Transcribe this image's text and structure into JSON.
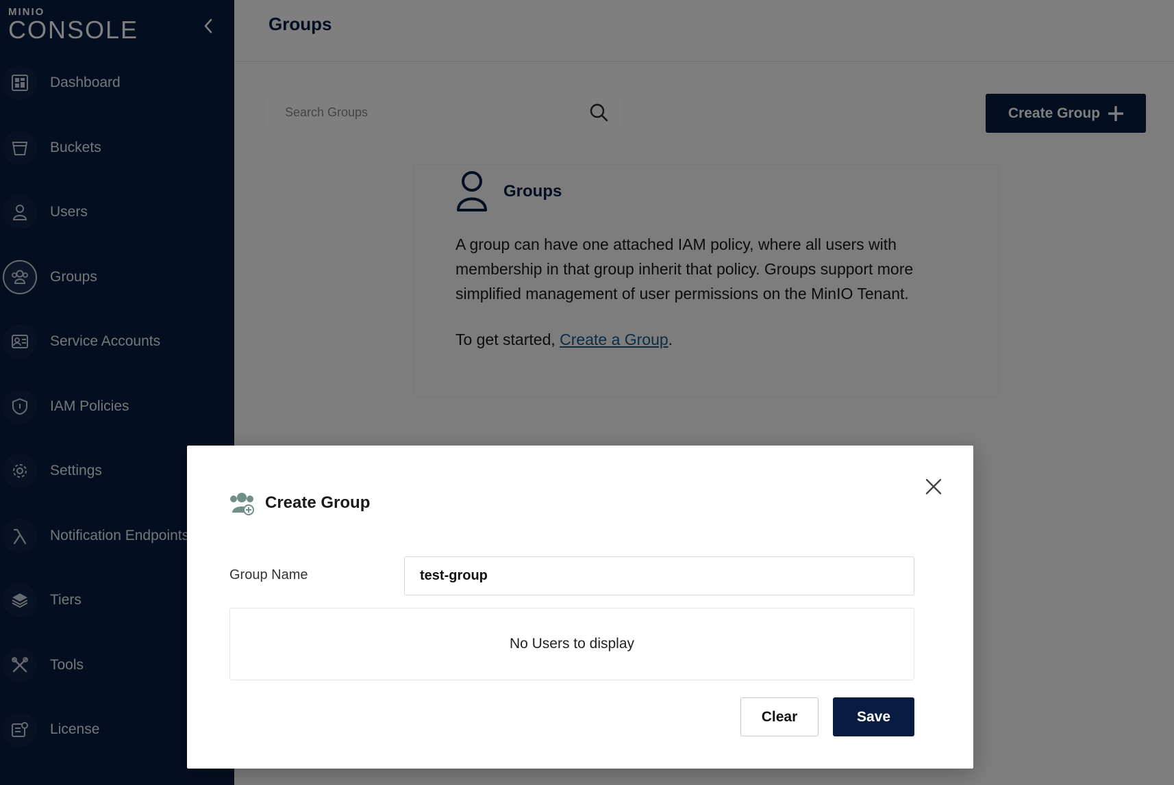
{
  "sidebar": {
    "logo_small": "MINIO",
    "logo_big": "CONSOLE",
    "items": [
      {
        "label": "Dashboard",
        "icon": "dashboard-icon"
      },
      {
        "label": "Buckets",
        "icon": "bucket-icon"
      },
      {
        "label": "Users",
        "icon": "user-icon"
      },
      {
        "label": "Groups",
        "icon": "groups-icon",
        "active": true
      },
      {
        "label": "Service Accounts",
        "icon": "service-accounts-icon"
      },
      {
        "label": "IAM Policies",
        "icon": "shield-icon"
      },
      {
        "label": "Settings",
        "icon": "gear-icon"
      },
      {
        "label": "Notification Endpoints",
        "icon": "lambda-icon"
      },
      {
        "label": "Tiers",
        "icon": "layers-icon"
      },
      {
        "label": "Tools",
        "icon": "tools-icon"
      },
      {
        "label": "License",
        "icon": "license-icon"
      }
    ]
  },
  "main": {
    "title": "Groups",
    "search_placeholder": "Search Groups",
    "create_button": "Create Group",
    "help": {
      "title": "Groups",
      "text": "A group can have one attached IAM policy, where all users with membership in that group inherit that policy. Groups support more simplified management of user permissions on the MinIO Tenant.",
      "start_prefix": "To get started, ",
      "start_link": "Create a Group",
      "start_suffix": "."
    }
  },
  "modal": {
    "title": "Create Group",
    "group_name_label": "Group Name",
    "group_name_value": "test-group",
    "users_empty": "No Users to display",
    "clear_label": "Clear",
    "save_label": "Save"
  },
  "colors": {
    "sidebar_bg": "#081c42",
    "primary": "#081c42",
    "link": "#1a5b8a",
    "overlay": "rgba(0,0,0,0.5)"
  }
}
